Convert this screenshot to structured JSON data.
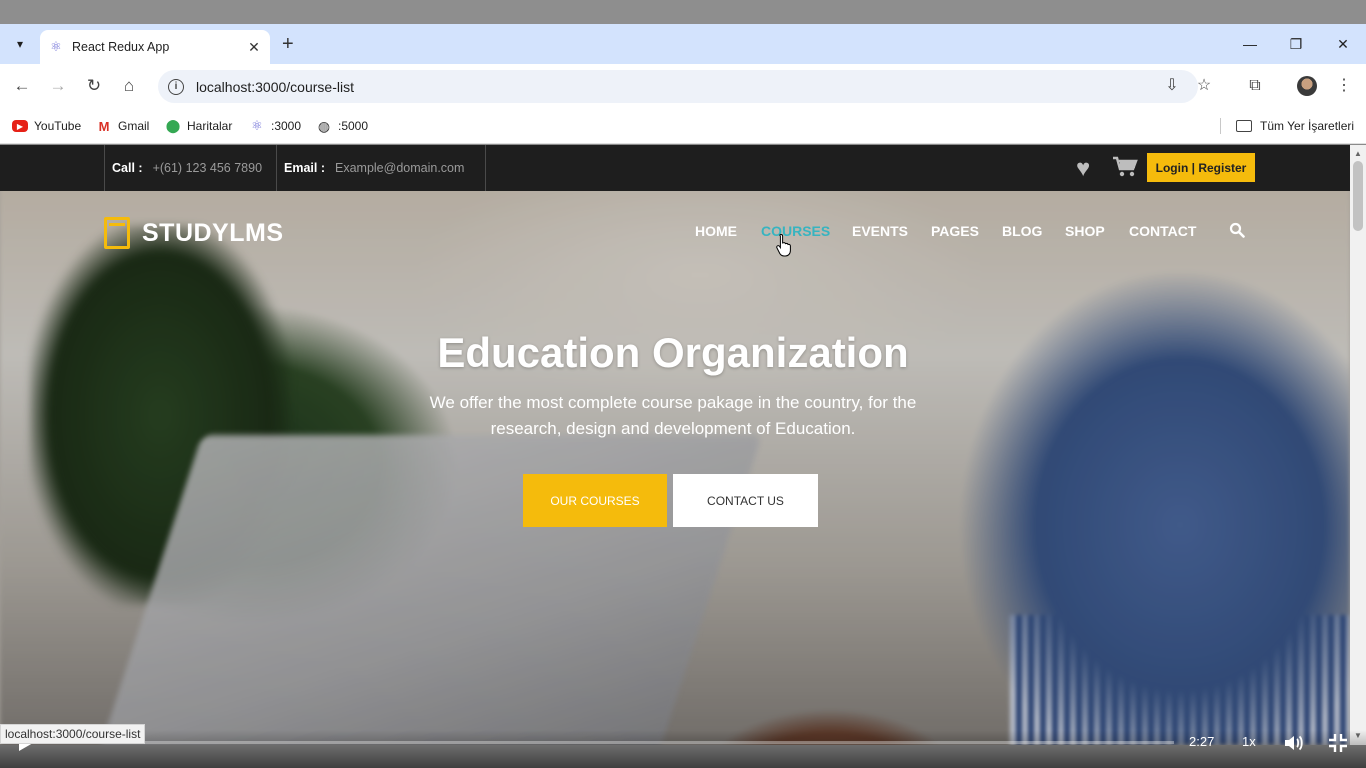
{
  "browser": {
    "tab": {
      "title": "React Redux App",
      "close": "✕"
    },
    "new_tab": "+",
    "window_controls": {
      "minimize": "—",
      "restore": "❐",
      "close": "✕"
    },
    "url": "localhost:3000/course-list",
    "bookmarks": [
      {
        "label": "YouTube",
        "icon": "youtube-icon"
      },
      {
        "label": "Gmail",
        "icon": "gmail-icon"
      },
      {
        "label": "Haritalar",
        "icon": "maps-pin-icon"
      },
      {
        "label": ":3000",
        "icon": "react-icon"
      },
      {
        "label": ":5000",
        "icon": "globe-icon"
      }
    ],
    "all_bookmarks": "Tüm Yer İşaretleri",
    "status_url": "localhost:3000/course-list"
  },
  "site": {
    "topbar": {
      "call_label": "Call :",
      "phone": "+(61) 123 456 7890",
      "email_label": "Email :",
      "email": "Example@domain.com",
      "login": "Login | Register"
    },
    "logo": "STUDYLMS",
    "menu": [
      "HOME",
      "COURSES",
      "EVENTS",
      "PAGES",
      "BLOG",
      "SHOP",
      "CONTACT"
    ],
    "active_menu": "COURSES",
    "hero": {
      "title": "Education Organization",
      "subtitle": "We offer the most complete course pakage in the country, for the research, design and development of Education.",
      "primary_button": "OUR COURSES",
      "secondary_button": "CONTACT US"
    },
    "colors": {
      "accent": "#f5bb0c",
      "active_link": "#37b4c0",
      "topbar_bg": "#1e1e1e"
    }
  },
  "video": {
    "time": "2:27",
    "speed": "1x",
    "progress": 0.07
  }
}
